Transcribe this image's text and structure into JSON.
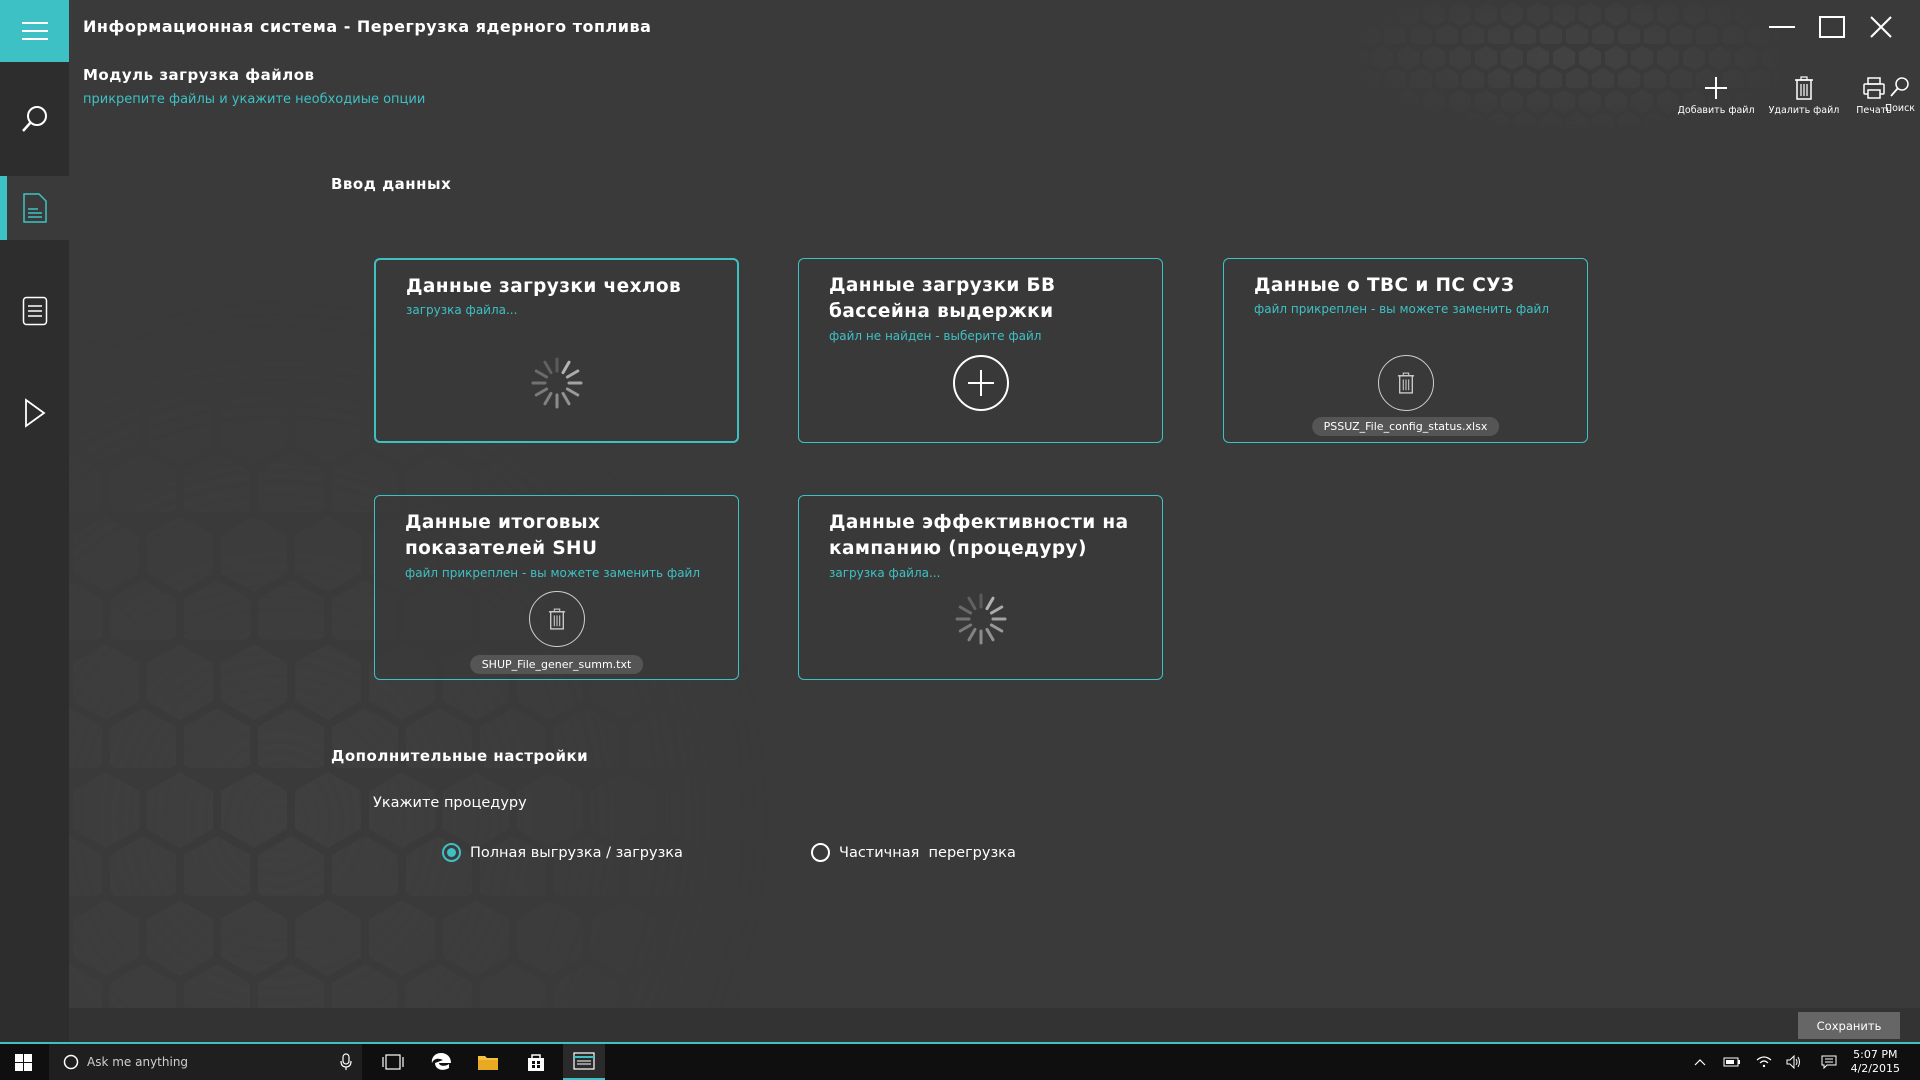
{
  "app": {
    "title": "Информационная система - Перегрузка ядерного топлива"
  },
  "module": {
    "title": "Модуль загрузка файлов",
    "subtitle": "прикрепите файлы и укажите необходиые опции"
  },
  "toolbar": {
    "add_label": "Добавить файл",
    "delete_label": "Удалить файл",
    "print_label": "Печать",
    "search_label": "Поиск"
  },
  "sections": {
    "input_title": "Ввод данных",
    "settings_title": "Дополнительные настройки"
  },
  "cards": [
    {
      "title": "Данные загрузки чехлов",
      "status": "загрузка файла...",
      "state": "loading"
    },
    {
      "title": "Данные загрузки БВ бассейна выдержки",
      "status": "файл не найден - выберите файл",
      "state": "empty"
    },
    {
      "title": "Данные о ТВС и ПС СУЗ",
      "status": "файл прикреплен - вы можете заменить файл",
      "state": "attached",
      "file": "PSSUZ_File_config_status.xlsx"
    },
    {
      "title": "Данные итоговых показателей SHU",
      "status": "файл прикреплен - вы можете заменить файл",
      "state": "attached",
      "file": "SHUP_File_gener_summ.txt"
    },
    {
      "title": "Данные эффективности на кампанию (процедуру)",
      "status": "загрузка файла...",
      "state": "loading"
    }
  ],
  "procedure": {
    "label": "Укажите процедуру",
    "options": [
      {
        "label": "Полная выгрузка / загрузка",
        "selected": true
      },
      {
        "label": "Частичная  перегрузка",
        "selected": false
      }
    ]
  },
  "footer": {
    "save_label": "Сохранить"
  },
  "taskbar": {
    "search_placeholder": "Ask me anything",
    "time": "5:07 PM",
    "date": "4/2/2015"
  },
  "colors": {
    "accent": "#3ec1c4",
    "background": "#3a3a3a",
    "sidebar": "#2d2d2d"
  }
}
